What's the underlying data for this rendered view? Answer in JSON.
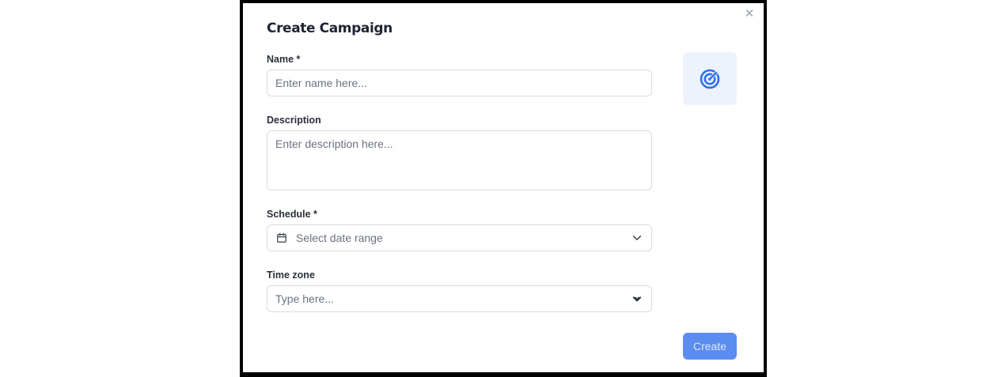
{
  "dialog": {
    "title": "Create Campaign",
    "close_icon": "close-icon"
  },
  "form": {
    "name": {
      "label": "Name *",
      "placeholder": "Enter name here...",
      "value": ""
    },
    "description": {
      "label": "Description",
      "placeholder": "Enter description here...",
      "value": ""
    },
    "schedule": {
      "label": "Schedule *",
      "placeholder": "Select date range",
      "icon": "calendar-icon",
      "dropdown_icon": "chevron-down-icon"
    },
    "timezone": {
      "label": "Time zone",
      "placeholder": "Type here...",
      "value": "",
      "dropdown_icon": "chevron-down-icon"
    }
  },
  "campaign_icon": "target-icon",
  "actions": {
    "create_label": "Create"
  },
  "colors": {
    "accent": "#5b8df0",
    "icon_blue": "#2f6ff0",
    "tile_bg": "#edf3fd"
  }
}
